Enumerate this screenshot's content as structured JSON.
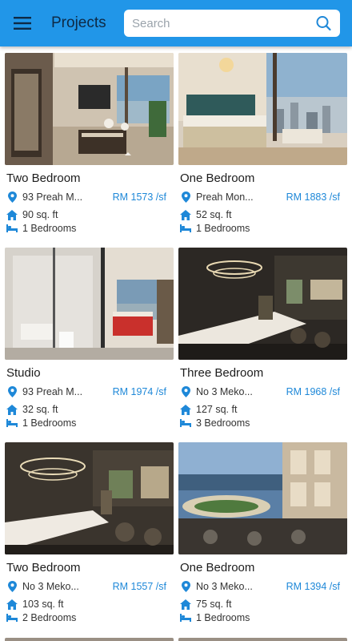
{
  "header": {
    "title": "Projects",
    "search_placeholder": "Search",
    "colors": {
      "appbar": "#2196e8",
      "price": "#1e88d8",
      "icon": "#1e88d8"
    }
  },
  "icons": {
    "menu": "hamburger-icon",
    "search": "search-icon",
    "location": "location-pin-icon",
    "area": "house-icon",
    "bedrooms": "bed-icon"
  },
  "projects": [
    {
      "name": "Two Bedroom",
      "location": "93 Preah M...",
      "price": "RM 1573",
      "unit": "/sf",
      "area": "90 sq. ft",
      "bedrooms": "1 Bedrooms"
    },
    {
      "name": "One Bedroom",
      "location": "Preah Mon...",
      "price": "RM 1883",
      "unit": "/sf",
      "area": "52 sq. ft",
      "bedrooms": "1 Bedrooms"
    },
    {
      "name": "Studio",
      "location": "93 Preah M...",
      "price": "RM 1974",
      "unit": "/sf",
      "area": "32 sq. ft",
      "bedrooms": "1 Bedrooms"
    },
    {
      "name": "Three Bedroom",
      "location": "No 3 Meko...",
      "price": "RM 1968",
      "unit": "/sf",
      "area": "127 sq. ft",
      "bedrooms": "3 Bedrooms"
    },
    {
      "name": "Two Bedroom",
      "location": "No 3 Meko...",
      "price": "RM 1557",
      "unit": "/sf",
      "area": "103 sq. ft",
      "bedrooms": "2 Bedrooms"
    },
    {
      "name": "One Bedroom",
      "location": "No 3 Meko...",
      "price": "RM 1394",
      "unit": "/sf",
      "area": "75 sq. ft",
      "bedrooms": "1 Bedrooms"
    }
  ]
}
